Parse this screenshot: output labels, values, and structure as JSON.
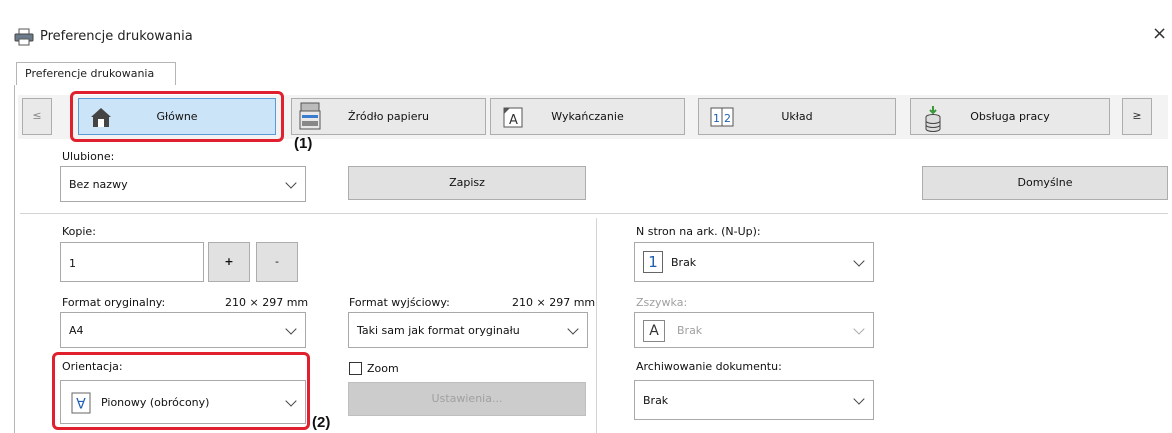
{
  "window": {
    "title": "Preferencje drukowania",
    "close_glyph": "×"
  },
  "tabs": [
    {
      "label": "Preferencje drukowania"
    }
  ],
  "nav": {
    "prev_glyph": "≤",
    "next_glyph": "≥",
    "items": [
      {
        "label": "Główne",
        "icon": "home-icon"
      },
      {
        "label": "Źródło papieru",
        "icon": "paper-tray-icon"
      },
      {
        "label": "Wykańczanie",
        "icon": "finishing-icon"
      },
      {
        "label": "Układ",
        "icon": "layout-icon"
      },
      {
        "label": "Obsługa pracy",
        "icon": "job-handling-icon"
      }
    ]
  },
  "callouts": {
    "one": "(1)",
    "two": "(2)"
  },
  "favorites": {
    "label": "Ulubione:",
    "value": "Bez nazwy",
    "save_label": "Zapisz",
    "defaults_label": "Domyślne"
  },
  "copies": {
    "label": "Kopie:",
    "value": "1",
    "plus": "+",
    "minus": "-"
  },
  "original_size": {
    "label": "Format oryginalny:",
    "dims": "210 × 297 mm",
    "value": "A4"
  },
  "output_size": {
    "label": "Format wyjściowy:",
    "dims": "210 × 297 mm",
    "value": "Taki sam jak format oryginału"
  },
  "orientation": {
    "label": "Orientacja:",
    "value": "Pionowy (obrócony)"
  },
  "zoom": {
    "label": "Zoom",
    "checked": false,
    "settings_label": "Ustawienia..."
  },
  "nup": {
    "label": "N stron na ark. (N-Up):",
    "value": "Brak",
    "icon_digit": "1"
  },
  "staple": {
    "label": "Zszywka:",
    "value": "Brak",
    "icon_letter": "A"
  },
  "archive": {
    "label": "Archiwowanie dokumentu:",
    "value": "Brak"
  },
  "colors": {
    "highlight": "#e0202e",
    "accent_blue": "#1e5fb4"
  }
}
